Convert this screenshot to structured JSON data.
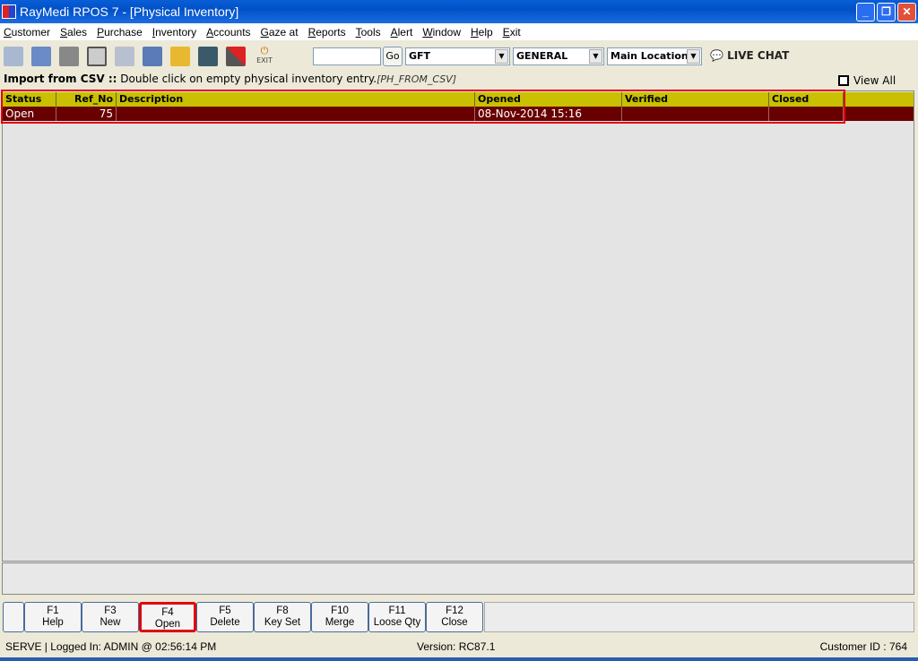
{
  "window": {
    "title": "RayMedi RPOS 7 - [Physical Inventory]"
  },
  "menu": [
    "Customer",
    "Sales",
    "Purchase",
    "Inventory",
    "Accounts",
    "Gaze at",
    "Reports",
    "Tools",
    "Alert",
    "Window",
    "Help",
    "Exit"
  ],
  "toolbar": {
    "exit_label": "EXIT",
    "search_value": "",
    "go_label": "Go",
    "combo1": "GFT",
    "combo2": "GENERAL",
    "combo3": "Main Location",
    "live_chat": "LIVE CHAT"
  },
  "info": {
    "title": "Import from CSV ::",
    "text": " Double click on empty physical inventory entry.",
    "code": "[PH_FROM_CSV]",
    "view_all": "View All"
  },
  "grid": {
    "columns": [
      "Status",
      "Ref_No",
      "Description",
      "Opened",
      "Verified",
      "Closed"
    ],
    "rows": [
      {
        "status": "Open",
        "ref_no": "75",
        "description": "",
        "opened": "08-Nov-2014 15:16",
        "verified": "",
        "closed": ""
      }
    ]
  },
  "fkeys": [
    {
      "key": "F1",
      "label": "Help"
    },
    {
      "key": "F3",
      "label": "New"
    },
    {
      "key": "F4",
      "label": "Open"
    },
    {
      "key": "F5",
      "label": "Delete"
    },
    {
      "key": "F8",
      "label": "Key Set"
    },
    {
      "key": "F10",
      "label": "Merge"
    },
    {
      "key": "F11",
      "label": "Loose Qty"
    },
    {
      "key": "F12",
      "label": "Close"
    }
  ],
  "status": {
    "left": "SERVE |  Logged In: ADMIN  @ 02:56:14 PM",
    "version": "Version: RC87.1",
    "customer": "Customer ID : 764"
  }
}
